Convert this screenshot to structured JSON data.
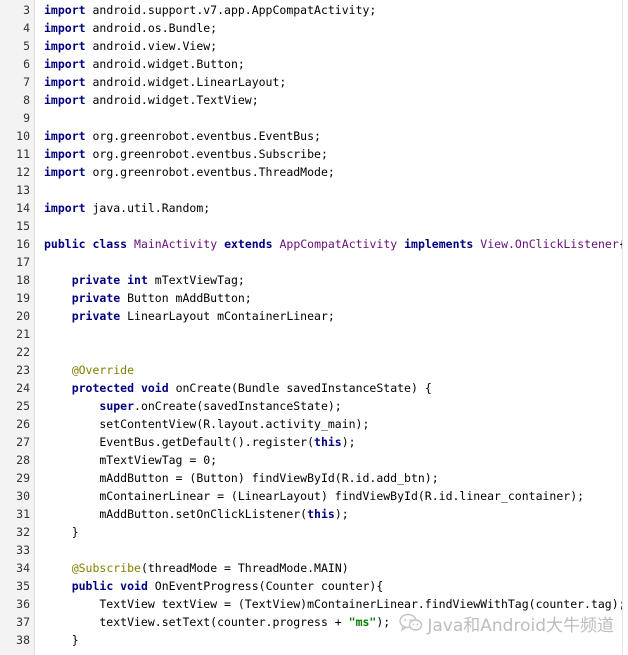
{
  "editor": {
    "lines": [
      {
        "num": "3",
        "segs": [
          {
            "c": "kw",
            "t": "import"
          },
          {
            "c": "",
            "t": " android.support.v7.app.AppCompatActivity;"
          }
        ]
      },
      {
        "num": "4",
        "segs": [
          {
            "c": "kw",
            "t": "import"
          },
          {
            "c": "",
            "t": " android.os.Bundle;"
          }
        ]
      },
      {
        "num": "5",
        "segs": [
          {
            "c": "kw",
            "t": "import"
          },
          {
            "c": "",
            "t": " android.view.View;"
          }
        ]
      },
      {
        "num": "6",
        "segs": [
          {
            "c": "kw",
            "t": "import"
          },
          {
            "c": "",
            "t": " android.widget.Button;"
          }
        ]
      },
      {
        "num": "7",
        "segs": [
          {
            "c": "kw",
            "t": "import"
          },
          {
            "c": "",
            "t": " android.widget.LinearLayout;"
          }
        ]
      },
      {
        "num": "8",
        "segs": [
          {
            "c": "kw",
            "t": "import"
          },
          {
            "c": "",
            "t": " android.widget.TextView;"
          }
        ]
      },
      {
        "num": "9",
        "segs": []
      },
      {
        "num": "10",
        "segs": [
          {
            "c": "kw",
            "t": "import"
          },
          {
            "c": "",
            "t": " org.greenrobot.eventbus.EventBus;"
          }
        ]
      },
      {
        "num": "11",
        "segs": [
          {
            "c": "kw",
            "t": "import"
          },
          {
            "c": "",
            "t": " org.greenrobot.eventbus.Subscribe;"
          }
        ]
      },
      {
        "num": "12",
        "segs": [
          {
            "c": "kw",
            "t": "import"
          },
          {
            "c": "",
            "t": " org.greenrobot.eventbus.ThreadMode;"
          }
        ]
      },
      {
        "num": "13",
        "segs": []
      },
      {
        "num": "14",
        "segs": [
          {
            "c": "kw",
            "t": "import"
          },
          {
            "c": "",
            "t": " java.util.Random;"
          }
        ]
      },
      {
        "num": "15",
        "segs": []
      },
      {
        "num": "16",
        "segs": [
          {
            "c": "kw",
            "t": "public class"
          },
          {
            "c": "",
            "t": " "
          },
          {
            "c": "ty",
            "t": "MainActivity"
          },
          {
            "c": "",
            "t": " "
          },
          {
            "c": "kw",
            "t": "extends"
          },
          {
            "c": "",
            "t": " "
          },
          {
            "c": "ty",
            "t": "AppCompatActivity"
          },
          {
            "c": "",
            "t": " "
          },
          {
            "c": "kw",
            "t": "implements"
          },
          {
            "c": "",
            "t": " "
          },
          {
            "c": "ty",
            "t": "View.OnClickListener"
          },
          {
            "c": "",
            "t": "{"
          }
        ]
      },
      {
        "num": "17",
        "segs": []
      },
      {
        "num": "18",
        "segs": [
          {
            "c": "",
            "t": "    "
          },
          {
            "c": "kw",
            "t": "private int"
          },
          {
            "c": "",
            "t": " mTextViewTag;"
          }
        ]
      },
      {
        "num": "19",
        "segs": [
          {
            "c": "",
            "t": "    "
          },
          {
            "c": "kw",
            "t": "private"
          },
          {
            "c": "",
            "t": " Button mAddButton;"
          }
        ]
      },
      {
        "num": "20",
        "segs": [
          {
            "c": "",
            "t": "    "
          },
          {
            "c": "kw",
            "t": "private"
          },
          {
            "c": "",
            "t": " LinearLayout mContainerLinear;"
          }
        ]
      },
      {
        "num": "21",
        "segs": []
      },
      {
        "num": "22",
        "segs": []
      },
      {
        "num": "23",
        "segs": [
          {
            "c": "",
            "t": "    "
          },
          {
            "c": "an",
            "t": "@Override"
          }
        ]
      },
      {
        "num": "24",
        "segs": [
          {
            "c": "",
            "t": "    "
          },
          {
            "c": "kw",
            "t": "protected void"
          },
          {
            "c": "",
            "t": " onCreate(Bundle savedInstanceState) {"
          }
        ]
      },
      {
        "num": "25",
        "segs": [
          {
            "c": "",
            "t": "        "
          },
          {
            "c": "kw",
            "t": "super"
          },
          {
            "c": "",
            "t": ".onCreate(savedInstanceState);"
          }
        ]
      },
      {
        "num": "26",
        "segs": [
          {
            "c": "",
            "t": "        setContentView(R.layout.activity_main);"
          }
        ]
      },
      {
        "num": "27",
        "segs": [
          {
            "c": "",
            "t": "        EventBus.getDefault().register("
          },
          {
            "c": "kw",
            "t": "this"
          },
          {
            "c": "",
            "t": ");"
          }
        ]
      },
      {
        "num": "28",
        "segs": [
          {
            "c": "",
            "t": "        mTextViewTag = 0;"
          }
        ]
      },
      {
        "num": "29",
        "segs": [
          {
            "c": "",
            "t": "        mAddButton = (Button) findViewById(R.id.add_btn);"
          }
        ]
      },
      {
        "num": "30",
        "segs": [
          {
            "c": "",
            "t": "        mContainerLinear = (LinearLayout) findViewById(R.id.linear_container);"
          }
        ]
      },
      {
        "num": "31",
        "segs": [
          {
            "c": "",
            "t": "        mAddButton.setOnClickListener("
          },
          {
            "c": "kw",
            "t": "this"
          },
          {
            "c": "",
            "t": ");"
          }
        ]
      },
      {
        "num": "32",
        "segs": [
          {
            "c": "",
            "t": "    }"
          }
        ]
      },
      {
        "num": "33",
        "segs": []
      },
      {
        "num": "34",
        "segs": [
          {
            "c": "",
            "t": "    "
          },
          {
            "c": "an",
            "t": "@Subscribe"
          },
          {
            "c": "",
            "t": "(threadMode = ThreadMode.MAIN)"
          }
        ]
      },
      {
        "num": "35",
        "segs": [
          {
            "c": "",
            "t": "    "
          },
          {
            "c": "kw",
            "t": "public void"
          },
          {
            "c": "",
            "t": " OnEventProgress(Counter counter){"
          }
        ]
      },
      {
        "num": "36",
        "segs": [
          {
            "c": "",
            "t": "        TextView textView = (TextView)mContainerLinear.findViewWithTag(counter.tag);"
          }
        ]
      },
      {
        "num": "37",
        "segs": [
          {
            "c": "",
            "t": "        textView.setText(counter.progress + "
          },
          {
            "c": "sr",
            "t": "\"ms\""
          },
          {
            "c": "",
            "t": ");"
          }
        ]
      },
      {
        "num": "38",
        "segs": [
          {
            "c": "",
            "t": "    }"
          }
        ]
      }
    ]
  },
  "watermark": {
    "text": "Java和Android大牛频道",
    "icon": "wechat-icon",
    "color": "#bdbdbd"
  }
}
